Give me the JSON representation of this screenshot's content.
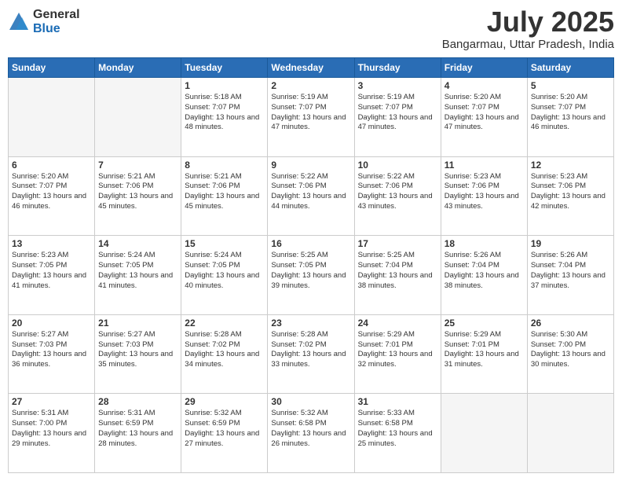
{
  "logo": {
    "general": "General",
    "blue": "Blue"
  },
  "header": {
    "month": "July 2025",
    "location": "Bangarmau, Uttar Pradesh, India"
  },
  "weekdays": [
    "Sunday",
    "Monday",
    "Tuesday",
    "Wednesday",
    "Thursday",
    "Friday",
    "Saturday"
  ],
  "weeks": [
    [
      {
        "day": "",
        "empty": true
      },
      {
        "day": "",
        "empty": true
      },
      {
        "day": "1",
        "sunrise": "Sunrise: 5:18 AM",
        "sunset": "Sunset: 7:07 PM",
        "daylight": "Daylight: 13 hours and 48 minutes."
      },
      {
        "day": "2",
        "sunrise": "Sunrise: 5:19 AM",
        "sunset": "Sunset: 7:07 PM",
        "daylight": "Daylight: 13 hours and 47 minutes."
      },
      {
        "day": "3",
        "sunrise": "Sunrise: 5:19 AM",
        "sunset": "Sunset: 7:07 PM",
        "daylight": "Daylight: 13 hours and 47 minutes."
      },
      {
        "day": "4",
        "sunrise": "Sunrise: 5:20 AM",
        "sunset": "Sunset: 7:07 PM",
        "daylight": "Daylight: 13 hours and 47 minutes."
      },
      {
        "day": "5",
        "sunrise": "Sunrise: 5:20 AM",
        "sunset": "Sunset: 7:07 PM",
        "daylight": "Daylight: 13 hours and 46 minutes."
      }
    ],
    [
      {
        "day": "6",
        "sunrise": "Sunrise: 5:20 AM",
        "sunset": "Sunset: 7:07 PM",
        "daylight": "Daylight: 13 hours and 46 minutes."
      },
      {
        "day": "7",
        "sunrise": "Sunrise: 5:21 AM",
        "sunset": "Sunset: 7:06 PM",
        "daylight": "Daylight: 13 hours and 45 minutes."
      },
      {
        "day": "8",
        "sunrise": "Sunrise: 5:21 AM",
        "sunset": "Sunset: 7:06 PM",
        "daylight": "Daylight: 13 hours and 45 minutes."
      },
      {
        "day": "9",
        "sunrise": "Sunrise: 5:22 AM",
        "sunset": "Sunset: 7:06 PM",
        "daylight": "Daylight: 13 hours and 44 minutes."
      },
      {
        "day": "10",
        "sunrise": "Sunrise: 5:22 AM",
        "sunset": "Sunset: 7:06 PM",
        "daylight": "Daylight: 13 hours and 43 minutes."
      },
      {
        "day": "11",
        "sunrise": "Sunrise: 5:23 AM",
        "sunset": "Sunset: 7:06 PM",
        "daylight": "Daylight: 13 hours and 43 minutes."
      },
      {
        "day": "12",
        "sunrise": "Sunrise: 5:23 AM",
        "sunset": "Sunset: 7:06 PM",
        "daylight": "Daylight: 13 hours and 42 minutes."
      }
    ],
    [
      {
        "day": "13",
        "sunrise": "Sunrise: 5:23 AM",
        "sunset": "Sunset: 7:05 PM",
        "daylight": "Daylight: 13 hours and 41 minutes."
      },
      {
        "day": "14",
        "sunrise": "Sunrise: 5:24 AM",
        "sunset": "Sunset: 7:05 PM",
        "daylight": "Daylight: 13 hours and 41 minutes."
      },
      {
        "day": "15",
        "sunrise": "Sunrise: 5:24 AM",
        "sunset": "Sunset: 7:05 PM",
        "daylight": "Daylight: 13 hours and 40 minutes."
      },
      {
        "day": "16",
        "sunrise": "Sunrise: 5:25 AM",
        "sunset": "Sunset: 7:05 PM",
        "daylight": "Daylight: 13 hours and 39 minutes."
      },
      {
        "day": "17",
        "sunrise": "Sunrise: 5:25 AM",
        "sunset": "Sunset: 7:04 PM",
        "daylight": "Daylight: 13 hours and 38 minutes."
      },
      {
        "day": "18",
        "sunrise": "Sunrise: 5:26 AM",
        "sunset": "Sunset: 7:04 PM",
        "daylight": "Daylight: 13 hours and 38 minutes."
      },
      {
        "day": "19",
        "sunrise": "Sunrise: 5:26 AM",
        "sunset": "Sunset: 7:04 PM",
        "daylight": "Daylight: 13 hours and 37 minutes."
      }
    ],
    [
      {
        "day": "20",
        "sunrise": "Sunrise: 5:27 AM",
        "sunset": "Sunset: 7:03 PM",
        "daylight": "Daylight: 13 hours and 36 minutes."
      },
      {
        "day": "21",
        "sunrise": "Sunrise: 5:27 AM",
        "sunset": "Sunset: 7:03 PM",
        "daylight": "Daylight: 13 hours and 35 minutes."
      },
      {
        "day": "22",
        "sunrise": "Sunrise: 5:28 AM",
        "sunset": "Sunset: 7:02 PM",
        "daylight": "Daylight: 13 hours and 34 minutes."
      },
      {
        "day": "23",
        "sunrise": "Sunrise: 5:28 AM",
        "sunset": "Sunset: 7:02 PM",
        "daylight": "Daylight: 13 hours and 33 minutes."
      },
      {
        "day": "24",
        "sunrise": "Sunrise: 5:29 AM",
        "sunset": "Sunset: 7:01 PM",
        "daylight": "Daylight: 13 hours and 32 minutes."
      },
      {
        "day": "25",
        "sunrise": "Sunrise: 5:29 AM",
        "sunset": "Sunset: 7:01 PM",
        "daylight": "Daylight: 13 hours and 31 minutes."
      },
      {
        "day": "26",
        "sunrise": "Sunrise: 5:30 AM",
        "sunset": "Sunset: 7:00 PM",
        "daylight": "Daylight: 13 hours and 30 minutes."
      }
    ],
    [
      {
        "day": "27",
        "sunrise": "Sunrise: 5:31 AM",
        "sunset": "Sunset: 7:00 PM",
        "daylight": "Daylight: 13 hours and 29 minutes."
      },
      {
        "day": "28",
        "sunrise": "Sunrise: 5:31 AM",
        "sunset": "Sunset: 6:59 PM",
        "daylight": "Daylight: 13 hours and 28 minutes."
      },
      {
        "day": "29",
        "sunrise": "Sunrise: 5:32 AM",
        "sunset": "Sunset: 6:59 PM",
        "daylight": "Daylight: 13 hours and 27 minutes."
      },
      {
        "day": "30",
        "sunrise": "Sunrise: 5:32 AM",
        "sunset": "Sunset: 6:58 PM",
        "daylight": "Daylight: 13 hours and 26 minutes."
      },
      {
        "day": "31",
        "sunrise": "Sunrise: 5:33 AM",
        "sunset": "Sunset: 6:58 PM",
        "daylight": "Daylight: 13 hours and 25 minutes."
      },
      {
        "day": "",
        "empty": true
      },
      {
        "day": "",
        "empty": true
      }
    ]
  ]
}
